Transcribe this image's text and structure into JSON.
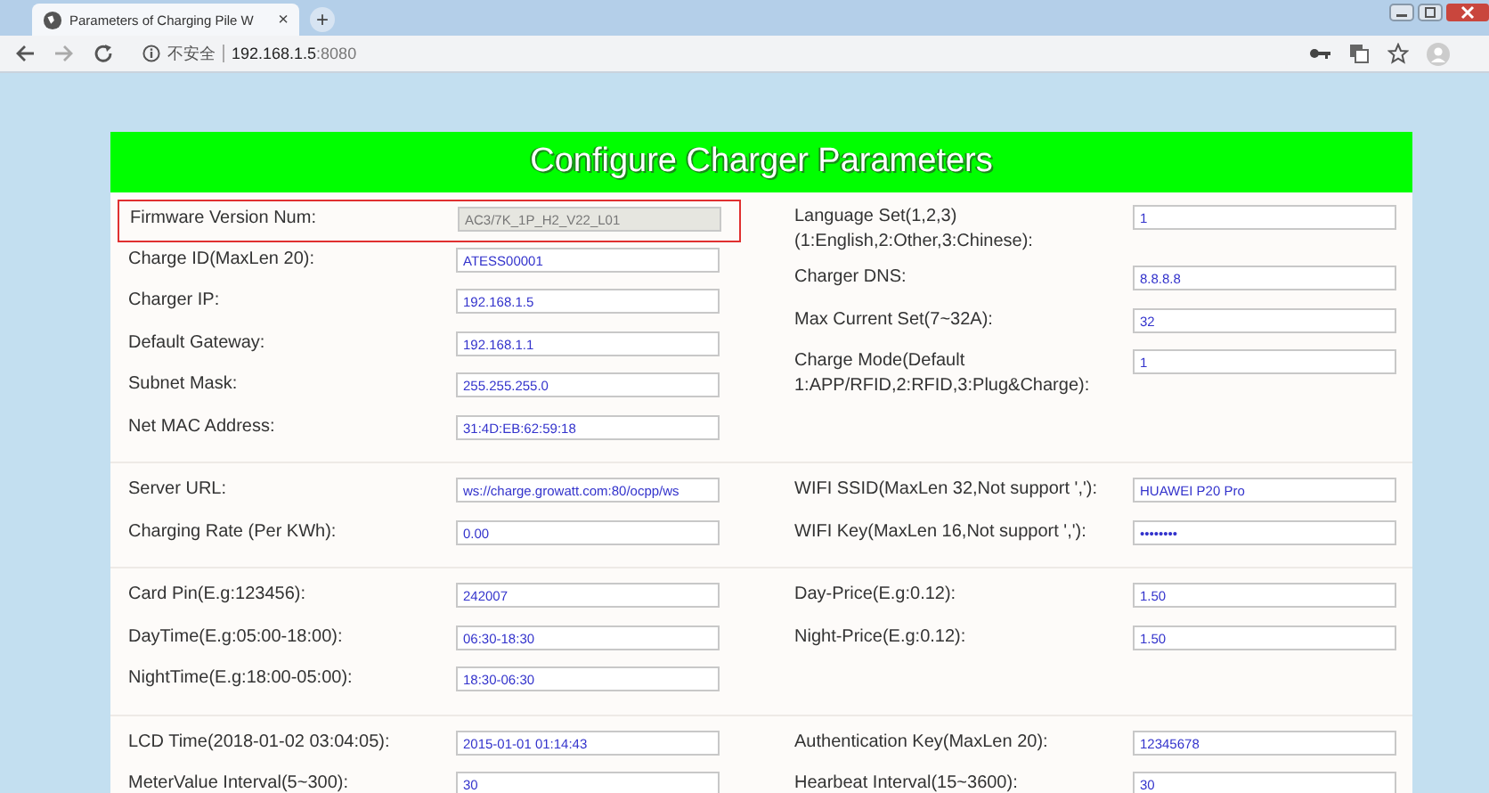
{
  "browser": {
    "tab_title": "Parameters of Charging Pile W",
    "new_tab": "+",
    "close": "×",
    "security": "不安全",
    "url_host": "192.168.1.5",
    "url_port": ":8080"
  },
  "page": {
    "title": "Configure Charger Parameters",
    "top_field": {
      "label": "Firmware Version Num:",
      "value": "AC3/7K_1P_H2_V22_L01",
      "disabled": true,
      "highlighted": true
    },
    "sections": [
      {
        "left": [
          {
            "label": "Charge ID(MaxLen 20):",
            "value": "ATESS00001",
            "disabled": false
          },
          {
            "label": "Charger IP:",
            "value": "192.168.1.5",
            "disabled": false
          },
          {
            "label": "Default Gateway:",
            "value": "192.168.1.1",
            "disabled": false
          },
          {
            "label": "Subnet Mask:",
            "value": "255.255.255.0",
            "disabled": false
          },
          {
            "label": "Net MAC Address:",
            "value": "31:4D:EB:62:59:18",
            "disabled": false
          }
        ],
        "right": [
          {
            "label": "Language Set(1,2,3)\n(1:English,2:Other,3:Chinese):",
            "value": "1",
            "disabled": false
          },
          {
            "label": "Charger DNS:",
            "value": "8.8.8.8",
            "disabled": false
          },
          {
            "label": "Max Current Set(7~32A):",
            "value": "32",
            "disabled": false
          },
          {
            "label": "Charge Mode(Default\n1:APP/RFID,2:RFID,3:Plug&Charge):",
            "value": "1",
            "disabled": false
          }
        ]
      },
      {
        "left": [
          {
            "label": "Server URL:",
            "value": "ws://charge.growatt.com:80/ocpp/ws",
            "disabled": false
          },
          {
            "label": "Charging Rate (Per KWh):",
            "value": "0.00",
            "disabled": false
          }
        ],
        "right": [
          {
            "label": "WIFI SSID(MaxLen 32,Not support ','):",
            "value": "HUAWEI P20 Pro",
            "disabled": false
          },
          {
            "label": "WIFI Key(MaxLen 16,Not support ','):",
            "value": "••••••••",
            "disabled": false
          }
        ]
      },
      {
        "left": [
          {
            "label": "Card Pin(E.g:123456):",
            "value": "242007",
            "disabled": false
          },
          {
            "label": "DayTime(E.g:05:00-18:00):",
            "value": "06:30-18:30",
            "disabled": false
          },
          {
            "label": "NightTime(E.g:18:00-05:00):",
            "value": "18:30-06:30",
            "disabled": false
          }
        ],
        "right": [
          {
            "label": "Day-Price(E.g:0.12):",
            "value": "1.50",
            "disabled": false
          },
          {
            "label": "Night-Price(E.g:0.12):",
            "value": "1.50",
            "disabled": false
          }
        ]
      },
      {
        "left": [
          {
            "label": "LCD Time(2018-01-02 03:04:05):",
            "value": "2015-01-01 01:14:43",
            "disabled": false
          },
          {
            "label": "MeterValue Interval(5~300):",
            "value": "30",
            "disabled": false
          }
        ],
        "right": [
          {
            "label": "Authentication Key(MaxLen 20):",
            "value": "12345678",
            "disabled": false
          },
          {
            "label": "Hearbeat Interval(15~3600):",
            "value": "30",
            "disabled": false
          }
        ]
      }
    ]
  }
}
